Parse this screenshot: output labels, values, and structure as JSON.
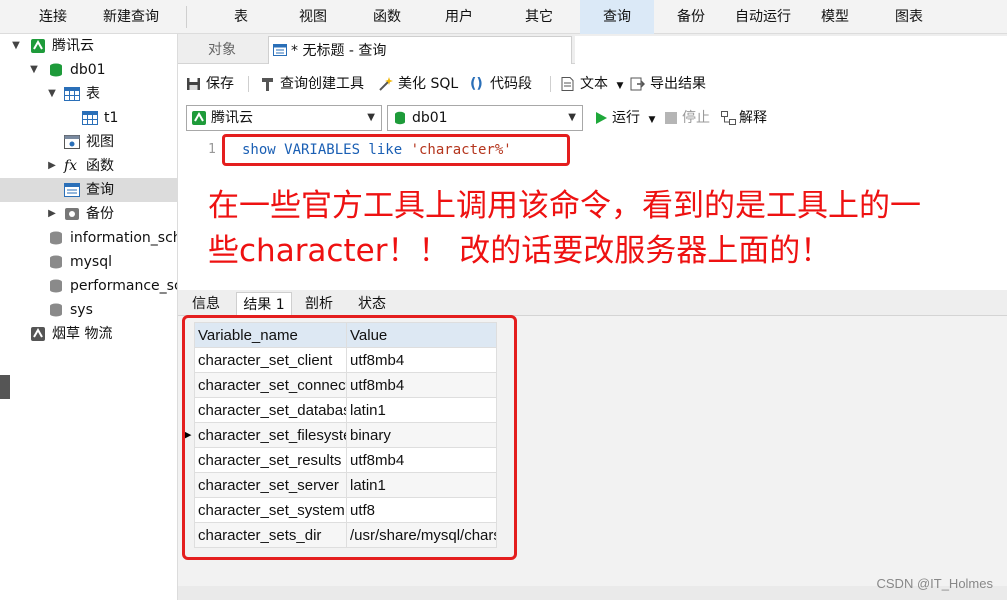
{
  "menubar": {
    "items": [
      "连接",
      "新建查询",
      "表",
      "视图",
      "函数",
      "用户",
      "其它",
      "查询",
      "备份",
      "自动运行",
      "模型",
      "图表"
    ],
    "active": "查询"
  },
  "sidebar": {
    "items": [
      {
        "label": "腾讯云",
        "icon": "connection-icon"
      },
      {
        "label": "db01",
        "icon": "database-icon"
      },
      {
        "label": "表",
        "icon": "table-icon"
      },
      {
        "label": "t1",
        "icon": "table-icon"
      },
      {
        "label": "视图",
        "icon": "view-icon"
      },
      {
        "label": "函数",
        "icon": "function-icon"
      },
      {
        "label": "查询",
        "icon": "query-icon"
      },
      {
        "label": "备份",
        "icon": "backup-icon"
      },
      {
        "label": "information_schema",
        "icon": "database-icon"
      },
      {
        "label": "mysql",
        "icon": "database-icon"
      },
      {
        "label": "performance_schema",
        "icon": "database-icon"
      },
      {
        "label": "sys",
        "icon": "database-icon"
      },
      {
        "label": "烟草 物流",
        "icon": "connection-icon"
      }
    ]
  },
  "tabs": {
    "objects": "对象",
    "query": "* 无标题 - 查询"
  },
  "toolbar": {
    "save": "保存",
    "builder": "查询创建工具",
    "beautify": "美化 SQL",
    "snippet": "代码段",
    "text": "文本",
    "export": "导出结果"
  },
  "selectors": {
    "connection": "腾讯云",
    "database": "db01",
    "run": "运行",
    "stop": "停止",
    "explain": "解释"
  },
  "editor": {
    "line_number": "1",
    "code_kw": "show VARIABLES like ",
    "code_str": "'character%'",
    "note_line1": "在一些官方工具上调用该命令，看到的是工具上的一",
    "note_line2": "些character！！ 改的话要改服务器上面的！"
  },
  "result_tabs": [
    "信息",
    "结果 1",
    "剖析",
    "状态"
  ],
  "grid": {
    "columns": [
      "Variable_name",
      "Value"
    ],
    "rows": [
      [
        "character_set_client",
        "utf8mb4"
      ],
      [
        "character_set_connection",
        "utf8mb4"
      ],
      [
        "character_set_database",
        "latin1"
      ],
      [
        "character_set_filesystem",
        "binary"
      ],
      [
        "character_set_results",
        "utf8mb4"
      ],
      [
        "character_set_server",
        "latin1"
      ],
      [
        "character_set_system",
        "utf8"
      ],
      [
        "character_sets_dir",
        "/usr/share/mysql/charsets/"
      ]
    ],
    "current_row": 3
  },
  "watermark": "CSDN @IT_Holmes",
  "colors": {
    "annotation_red": "#e41e1e",
    "active_menu": "#dbe9f7",
    "header_bg": "#dde8f3",
    "keyword": "#1a5fb4",
    "string": "#b5361e"
  }
}
